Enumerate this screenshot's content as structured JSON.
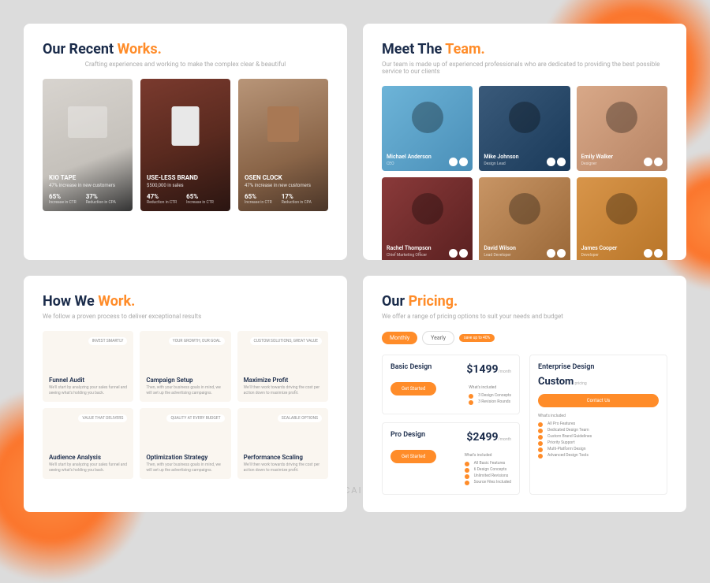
{
  "watermark": "素材湾 SUCAIWAN.COM",
  "works": {
    "title_pre": "Our Recent ",
    "title_accent": "Works.",
    "subtitle": "Crafting experiences and working to make the complex clear & beautiful",
    "cards": [
      {
        "title": "KIO TAPE",
        "sub": "47% increase in new customers",
        "s1": "65%",
        "s1l": "Increase in CTR",
        "s2": "37%",
        "s2l": "Reduction in CPA"
      },
      {
        "title": "USE-LESS BRAND",
        "sub": "$500,000 in sales",
        "s1": "47%",
        "s1l": "Reduction in CTR",
        "s2": "65%",
        "s2l": "Increase in CTR"
      },
      {
        "title": "OSEN CLOCK",
        "sub": "47% increase in new customers",
        "s1": "65%",
        "s1l": "Increase in CTR",
        "s2": "17%",
        "s2l": "Reduction in CPA"
      }
    ]
  },
  "team": {
    "title_pre": "Meet The ",
    "title_accent": "Team.",
    "subtitle": "Our team is made up of experienced professionals who are dedicated to providing the best possible service to our clients",
    "members": [
      {
        "name": "Michael Anderson",
        "role": "CEO"
      },
      {
        "name": "Mike Johnson",
        "role": "Design Lead"
      },
      {
        "name": "Emily Walker",
        "role": "Designer"
      },
      {
        "name": "Rachel Thompson",
        "role": "Chief Marketing Officer"
      },
      {
        "name": "David Wilson",
        "role": "Lead Developer"
      },
      {
        "name": "James Cooper",
        "role": "Developer"
      }
    ]
  },
  "howwework": {
    "title_pre": "How We ",
    "title_accent": "Work.",
    "subtitle": "We follow a proven process to deliver exceptional results",
    "cards": [
      {
        "tag": "INVEST SMARTLY",
        "title": "Funnel Audit",
        "desc": "We'll start by analyzing your sales funnel and seeing what's holding you back."
      },
      {
        "tag": "YOUR GROWTH, OUR GOAL",
        "title": "Campaign Setup",
        "desc": "Then, with your business goals in mind, we will set up the advertising campaigns."
      },
      {
        "tag": "CUSTOM SOLUTIONS, GREAT VALUE",
        "title": "Maximize Profit",
        "desc": "We'll then work towards driving the cost per action down to maximize profit."
      },
      {
        "tag": "VALUE THAT DELIVERS",
        "title": "Audience Analysis",
        "desc": "We'll start by analyzing your sales funnel and seeing what's holding you back."
      },
      {
        "tag": "QUALITY AT EVERY BUDGET",
        "title": "Optimization Strategy",
        "desc": "Then, with your business goals in mind, we will set up the advertising campaigns."
      },
      {
        "tag": "SCALABLE OPTIONS",
        "title": "Performance Scaling",
        "desc": "We'll then work towards driving the cost per action down to maximize profit."
      }
    ]
  },
  "pricing": {
    "title_pre": "Our ",
    "title_accent": "Pricing.",
    "subtitle": "We offer a range of pricing options to suit your needs and budget",
    "toggle": {
      "monthly": "Monthly",
      "yearly": "Yearly",
      "badge": "save up to 40%"
    },
    "plans": {
      "basic": {
        "name": "Basic Design",
        "price": "$1499",
        "period": "/month",
        "cta": "Get Started",
        "includes": "What's included",
        "features": [
          "3 Design Concepts",
          "3 Revision Rounds"
        ]
      },
      "pro": {
        "name": "Pro Design",
        "price": "$2499",
        "period": "/month",
        "cta": "Get Started",
        "includes": "What's included",
        "features": [
          "All Basic Features",
          "6 Design Concepts",
          "Unlimited Revisions",
          "Source Files Included"
        ]
      },
      "enterprise": {
        "name": "Enterprise Design",
        "price": "Custom",
        "period": " pricing",
        "cta": "Contact Us",
        "includes": "What's included",
        "features": [
          "All Pro Features",
          "Dedicated Design Team",
          "Custom Brand Guidelines",
          "Priority Support",
          "Multi-Platform Design",
          "Advanced Design Tools"
        ]
      }
    }
  }
}
